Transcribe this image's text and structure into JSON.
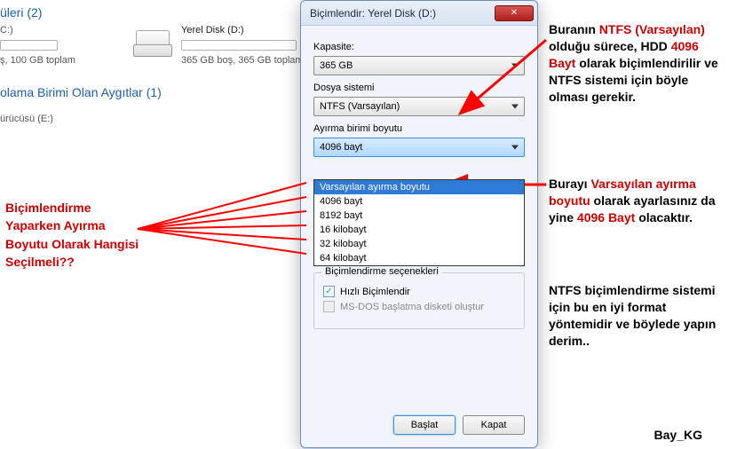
{
  "bg": {
    "drives_heading_suffix": "üleri (2)",
    "drive_c": "C:)",
    "drive_c_sub": "ş, 100 GB toplam",
    "drive_d_name": "Yerel Disk (D:)",
    "drive_d_sub": "365 GB boş, 365 GB toplam",
    "removable_heading": "olama Birimi Olan Aygıtlar (1)",
    "drive_e": "ürücüsü (E:)"
  },
  "dialog": {
    "title": "Biçimlendir: Yerel Disk (D:)",
    "capacity_label": "Kapasite:",
    "capacity_value": "365 GB",
    "fs_label": "Dosya sistemi",
    "fs_value": "NTFS (Varsayılan)",
    "alloc_label": "Ayırma birimi boyutu",
    "alloc_value": "4096 bayt",
    "alloc_options": [
      "Varsayılan ayırma boyutu",
      "4096 bayt",
      "8192 bayt",
      "16 kilobayt",
      "32 kilobayt",
      "64 kilobayt"
    ],
    "group_title": "Biçimlendirme seçenekleri",
    "quick_format": "Hızlı Biçimlendir",
    "msdos": "MS-DOS başlatma disketi oluştur",
    "start_btn": "Başlat",
    "close_btn": "Kapat"
  },
  "ann": {
    "left1": "Biçimlendirme",
    "left2": "Yaparken",
    "left2u": "Ayırma",
    "left3u": "Boyutu",
    "left3": "Olarak Hangisi",
    "left4": "Seçilmeli??",
    "r1a": "Buranın",
    "r1b": "NTFS (Varsayılan)",
    "r1c": "olduğu sürece, HDD",
    "r1d": "4096 Bayt",
    "r1e": "olarak biçimlendirilir ve NTFS sistemi için böyle olması gerekir.",
    "r2a": "Burayı",
    "r2b": "Varsayılan ayırma boyutu",
    "r2c": "olarak ayarlasınız da yine",
    "r2d": "4096 Bayt",
    "r2e": "olacaktır.",
    "r3": "NTFS biçimlendirme sistemi için bu en iyi format yöntemidir ve böylede yapın derim..",
    "sig": "Bay_KG"
  }
}
